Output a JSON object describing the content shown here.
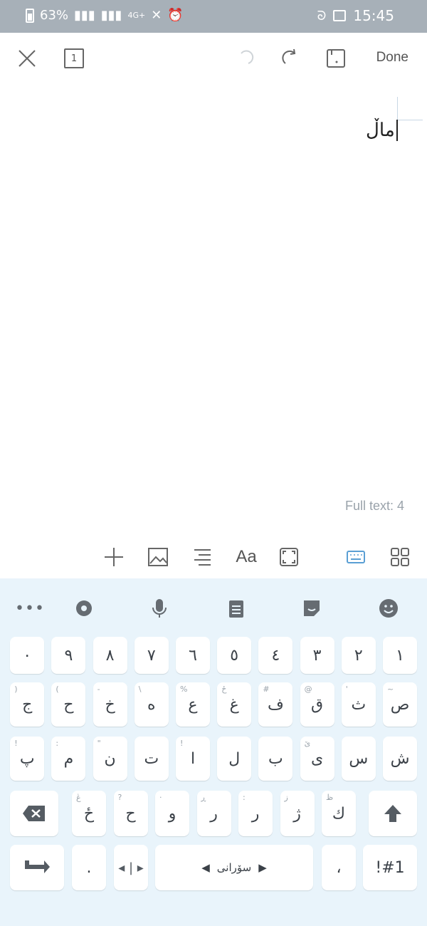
{
  "status_bar": {
    "time": "15:45",
    "battery_percent": "63%",
    "network": "4G+"
  },
  "toolbar": {
    "done_label": "Done",
    "close_icon": "close-icon",
    "page_icon_label": "1"
  },
  "canvas": {
    "written_text": "ماڵ",
    "full_text_label": "Full text: 4"
  },
  "tools": [
    "grid-icon",
    "keyboard-icon",
    "fit-icon",
    "text-size-icon",
    "align-icon",
    "image-icon",
    "add-icon"
  ],
  "keyboard": {
    "row0": [
      "emoji-icon",
      "sticker-icon",
      "clipboard-icon",
      "mic-icon",
      "settings-icon",
      "more-icon"
    ],
    "numbers": [
      "١",
      "٢",
      "٣",
      "٤",
      "٥",
      "٦",
      "٧",
      "٨",
      "٩",
      "٠"
    ],
    "row2": [
      {
        "main": "ص",
        "sub": "~"
      },
      {
        "main": "ث",
        "sub": "'"
      },
      {
        "main": "ق",
        "sub": "@"
      },
      {
        "main": "ف",
        "sub": "#"
      },
      {
        "main": "غ",
        "sub": "ځ"
      },
      {
        "main": "ع",
        "sub": "%"
      },
      {
        "main": "ه",
        "sub": "\\"
      },
      {
        "main": "خ",
        "sub": "-"
      },
      {
        "main": "ح",
        "sub": "("
      },
      {
        "main": "ج",
        "sub": ")"
      }
    ],
    "row3": [
      {
        "main": "ش",
        "sub": ""
      },
      {
        "main": "س",
        "sub": ""
      },
      {
        "main": "ی",
        "sub": "ێ"
      },
      {
        "main": "ب",
        "sub": ""
      },
      {
        "main": "ل",
        "sub": ""
      },
      {
        "main": "ا",
        "sub": "!"
      },
      {
        "main": "ت",
        "sub": ""
      },
      {
        "main": "ن",
        "sub": "\""
      },
      {
        "main": "م",
        "sub": ":"
      },
      {
        "main": "پ",
        "sub": "!"
      }
    ],
    "row4": [
      {
        "main": "ك",
        "sub": "ظ"
      },
      {
        "main": "ژ",
        "sub": "ز"
      },
      {
        "main": "ر",
        "sub": ":"
      },
      {
        "main": "ر",
        "sub": "ڕ"
      },
      {
        "main": "و",
        "sub": "·"
      },
      {
        "main": "ح",
        "sub": "?"
      },
      {
        "main": "ځ",
        "sub": "ڠ"
      }
    ],
    "space_label": "سۆرانی",
    "period_label": ".",
    "comma_label": "،",
    "symbols_label": "!#1",
    "colors": {
      "background": "#e9f4fb",
      "key": "#ffffff",
      "key_text": "#3b4148"
    }
  }
}
